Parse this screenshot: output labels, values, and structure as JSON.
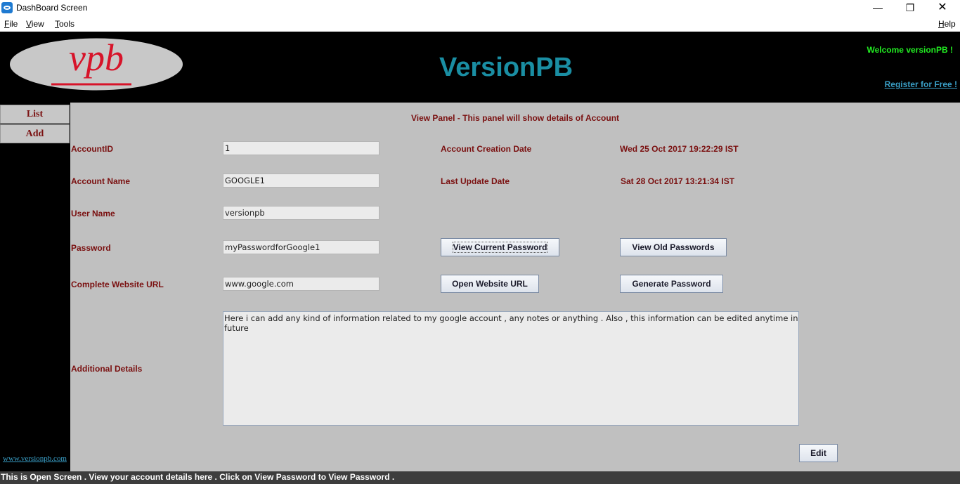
{
  "window": {
    "title": "DashBoard Screen",
    "minimize": "—",
    "maximize": "❐",
    "close": "✕"
  },
  "menu": {
    "file": "File",
    "view": "View",
    "tools": "Tools",
    "help": "Help"
  },
  "header": {
    "logo_text": "vpb",
    "app_name": "VersionPB",
    "welcome": "Welcome versionPB !",
    "register": "Register for Free !"
  },
  "sidebar": {
    "items": [
      {
        "label": "List"
      },
      {
        "label": "Add"
      }
    ],
    "site_link": "www.versionpb.com"
  },
  "panel": {
    "title": "View Panel - This panel will show details of Account",
    "account_id": {
      "label": "AccountID",
      "value": "1"
    },
    "account_name": {
      "label": "Account Name",
      "value": "GOOGLE1"
    },
    "user_name": {
      "label": "User Name",
      "value": "versionpb"
    },
    "password": {
      "label": "Password",
      "value": "myPasswordforGoogle1"
    },
    "website_url": {
      "label": "Complete Website URL",
      "value": "www.google.com"
    },
    "additional_details": {
      "label": "Additional Details",
      "value": "Here i can add any kind of information related to my google account , any notes or anything . Also , this information can be edited anytime in future"
    },
    "creation_date": {
      "label": "Account Creation Date",
      "value": "Wed 25 Oct 2017 19:22:29 IST"
    },
    "update_date": {
      "label": "Last Update Date",
      "value": "Sat 28 Oct 2017 13:21:34 IST"
    },
    "buttons": {
      "view_current_password": "View Current Password",
      "view_old_passwords": "View Old Passwords",
      "open_website_url": "Open Website URL",
      "generate_password": "Generate Password",
      "edit": "Edit"
    }
  },
  "status": "This is Open Screen . View your account details here . Click on View Password to View Password .",
  "colors": {
    "label": "#7a1010",
    "app_name": "#1a8ea3",
    "welcome": "#22ee22",
    "link": "#3aa0c8",
    "panel_bg": "#c0c0c0"
  }
}
